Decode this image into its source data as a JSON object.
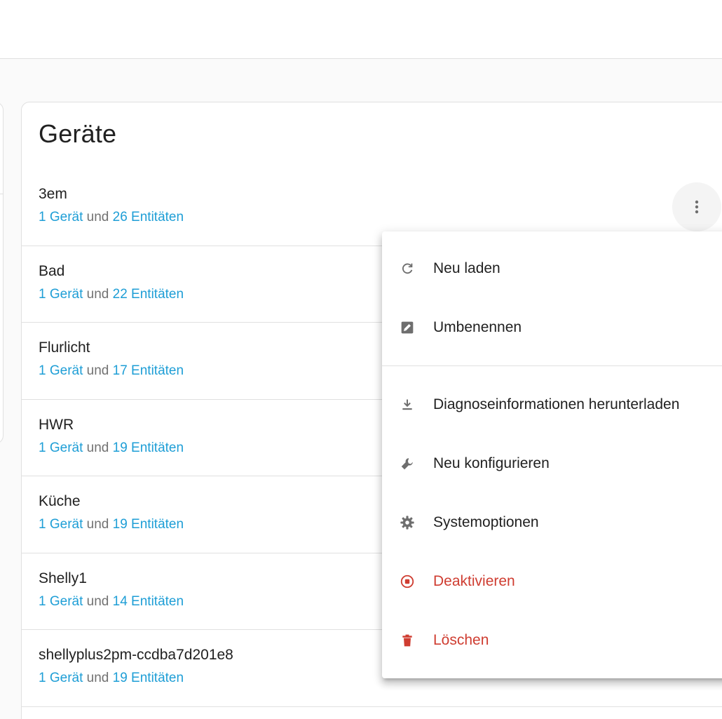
{
  "card": {
    "title": "Geräte"
  },
  "devices": [
    {
      "name": "3em",
      "devices_link": "1 Gerät",
      "and": "und",
      "entities_link": "26 Entitäten"
    },
    {
      "name": "Bad",
      "devices_link": "1 Gerät",
      "and": "und",
      "entities_link": "22 Entitäten"
    },
    {
      "name": "Flurlicht",
      "devices_link": "1 Gerät",
      "and": "und",
      "entities_link": "17 Entitäten"
    },
    {
      "name": "HWR",
      "devices_link": "1 Gerät",
      "and": "und",
      "entities_link": "19 Entitäten"
    },
    {
      "name": "Küche",
      "devices_link": "1 Gerät",
      "and": "und",
      "entities_link": "19 Entitäten"
    },
    {
      "name": "Shelly1",
      "devices_link": "1 Gerät",
      "and": "und",
      "entities_link": "14 Entitäten"
    },
    {
      "name": "shellyplus2pm-ccdba7d201e8",
      "devices_link": "1 Gerät",
      "and": "und",
      "entities_link": "19 Entitäten"
    }
  ],
  "menu": {
    "items": [
      {
        "label": "Neu laden",
        "icon": "reload-icon"
      },
      {
        "label": "Umbenennen",
        "icon": "rename-icon"
      },
      {
        "label": "Diagnoseinformationen herunterladen",
        "icon": "download-icon"
      },
      {
        "label": "Neu konfigurieren",
        "icon": "wrench-icon"
      },
      {
        "label": "Systemoptionen",
        "icon": "gear-icon"
      },
      {
        "label": "Deaktivieren",
        "icon": "stop-circle-icon"
      },
      {
        "label": "Löschen",
        "icon": "trash-icon"
      }
    ]
  },
  "colors": {
    "link": "#1e9ed6",
    "danger": "#cf3d31",
    "icon": "#6e6e6e"
  }
}
